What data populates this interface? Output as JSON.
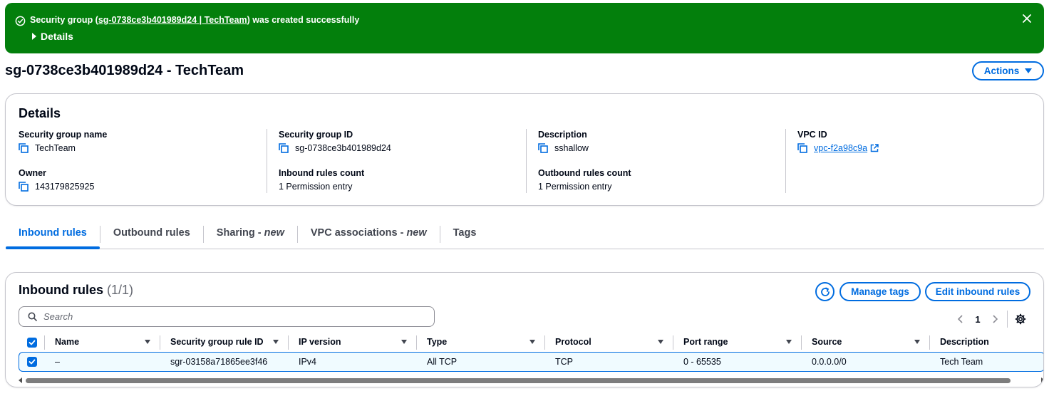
{
  "flash": {
    "prefix": "Security group (",
    "link": "sg-0738ce3b401989d24 | TechTeam",
    "suffix": ") was created successfully",
    "details_label": "Details"
  },
  "page": {
    "title": "sg-0738ce3b401989d24 - TechTeam",
    "actions_label": "Actions"
  },
  "details": {
    "title": "Details",
    "fields": {
      "sg_name": {
        "label": "Security group name",
        "value": "TechTeam"
      },
      "sg_id": {
        "label": "Security group ID",
        "value": "sg-0738ce3b401989d24"
      },
      "description": {
        "label": "Description",
        "value": "sshallow"
      },
      "vpc_id": {
        "label": "VPC ID",
        "value": "vpc-f2a98c9a"
      },
      "owner": {
        "label": "Owner",
        "value": "143179825925"
      },
      "inbound_count": {
        "label": "Inbound rules count",
        "value": "1 Permission entry"
      },
      "outbound_count": {
        "label": "Outbound rules count",
        "value": "1 Permission entry"
      }
    }
  },
  "tabs": {
    "inbound": "Inbound rules",
    "outbound": "Outbound rules",
    "sharing": "Sharing - ",
    "sharing_new": "new",
    "vpc_assoc": "VPC associations - ",
    "vpc_assoc_new": "new",
    "tags": "Tags"
  },
  "inbound": {
    "title": "Inbound rules",
    "count": "(1/1)",
    "manage_tags_label": "Manage tags",
    "edit_label": "Edit inbound rules",
    "search_placeholder": "Search",
    "page": "1",
    "columns": {
      "name": "Name",
      "rule_id": "Security group rule ID",
      "ip_version": "IP version",
      "type": "Type",
      "protocol": "Protocol",
      "port_range": "Port range",
      "source": "Source",
      "description": "Description"
    },
    "rows": [
      {
        "name": "–",
        "rule_id": "sgr-03158a71865ee3f46",
        "ip_version": "IPv4",
        "type": "All TCP",
        "protocol": "TCP",
        "port_range": "0 - 65535",
        "source": "0.0.0.0/0",
        "description": "Tech Team"
      }
    ]
  },
  "colors": {
    "success": "#037f0c",
    "accent": "#006ce0",
    "border": "#c6c6cd",
    "row_selected": "#f0fbff"
  }
}
